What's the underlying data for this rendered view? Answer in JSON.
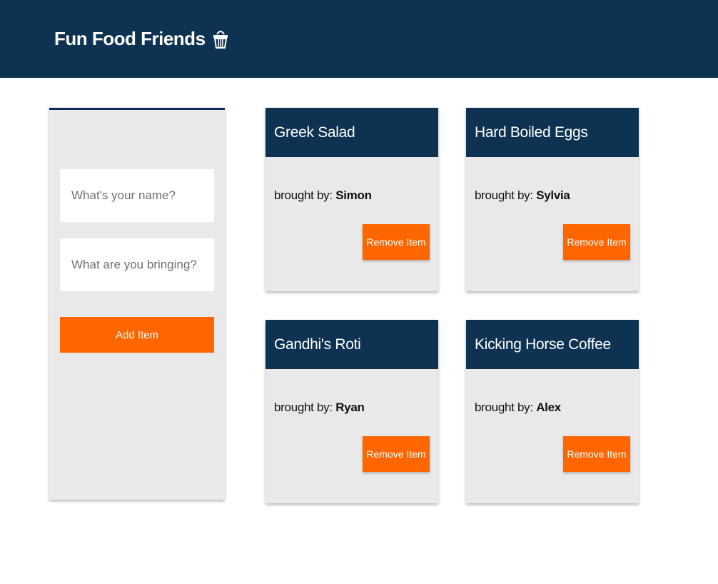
{
  "header": {
    "title": "Fun Food Friends",
    "icon": "basket-icon",
    "background": "#0e3252"
  },
  "form": {
    "name_placeholder": "What's your name?",
    "bringing_placeholder": "What are you bringing?",
    "add_label": "Add Item"
  },
  "items": [
    {
      "title": "Greek Salad",
      "brought_by_label": "brought by:",
      "person": "Simon",
      "remove_label": "Remove Item"
    },
    {
      "title": "Hard Boiled Eggs",
      "brought_by_label": "brought by:",
      "person": "Sylvia",
      "remove_label": "Remove Item"
    },
    {
      "title": "Gandhi's Roti",
      "brought_by_label": "brought by:",
      "person": "Ryan",
      "remove_label": "Remove Item"
    },
    {
      "title": "Kicking Horse Coffee",
      "brought_by_label": "brought by:",
      "person": "Alex",
      "remove_label": "Remove Item"
    }
  ],
  "colors": {
    "primary": "#0e3252",
    "accent": "#ff6600",
    "panel": "#e9e9e9"
  }
}
